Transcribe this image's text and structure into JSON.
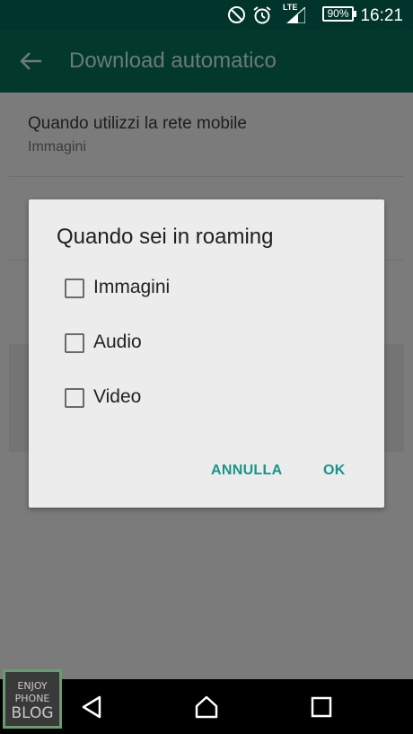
{
  "status_bar": {
    "time": "16:21",
    "battery": "90%",
    "network": "LTE",
    "icons": [
      "do-not-disturb-icon",
      "alarm-icon",
      "signal-icon",
      "battery-icon"
    ]
  },
  "toolbar": {
    "back_icon": "arrow-left-icon",
    "title": "Download automatico"
  },
  "settings": {
    "items": [
      {
        "title": "Quando utilizzi la rete mobile",
        "summary": "Immagini"
      }
    ]
  },
  "dialog": {
    "title": "Quando sei in roaming",
    "options": [
      {
        "label": "Immagini",
        "checked": false
      },
      {
        "label": "Audio",
        "checked": false
      },
      {
        "label": "Video",
        "checked": false
      }
    ],
    "cancel_label": "ANNULLA",
    "ok_label": "OK"
  },
  "nav_bar": {
    "icons": [
      "back-triangle-icon",
      "home-icon",
      "recents-icon"
    ]
  },
  "watermark": {
    "line1": "ENJOY",
    "line2": "PHONE",
    "line3": "BLOG"
  },
  "colors": {
    "status_bar": "#01342a",
    "toolbar": "#03382d",
    "accent": "#17958a",
    "dialog_bg": "#ececec",
    "scrim": "#7b7b7b"
  }
}
